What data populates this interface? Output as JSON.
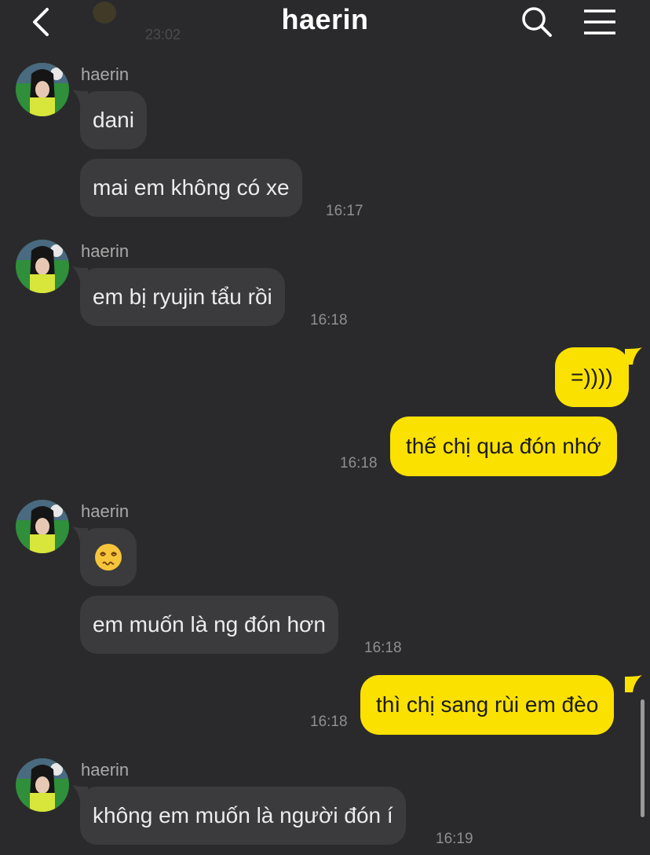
{
  "header": {
    "title": "haerin",
    "prev_time": "23:02",
    "back_icon": "chevron-left-icon",
    "search_icon": "search-icon",
    "menu_icon": "hamburger-menu-icon"
  },
  "colors": {
    "background": "#2a2a2c",
    "incoming_bubble": "#3b3b3e",
    "outgoing_bubble": "#fbe100"
  },
  "messages": {
    "g1": {
      "sender": "haerin",
      "m1": "dani",
      "m2": "mai em không có xe",
      "time": "16:17"
    },
    "g2": {
      "sender": "haerin",
      "m1": "em bị ryujin tẩu rồi",
      "time": "16:18"
    },
    "o1": {
      "m1": "=))))",
      "m2": "thế chị qua đón nhớ",
      "time": "16:18"
    },
    "g3": {
      "sender": "haerin",
      "m1_emoji": "dizzy-face-emoji",
      "m2": "em muốn là ng đón hơn",
      "time": "16:18"
    },
    "o2": {
      "m1": "thì chị sang rùi em đèo",
      "time": "16:18"
    },
    "g4": {
      "sender": "haerin",
      "m1": "không em muốn là người đón í",
      "time": "16:19"
    }
  }
}
